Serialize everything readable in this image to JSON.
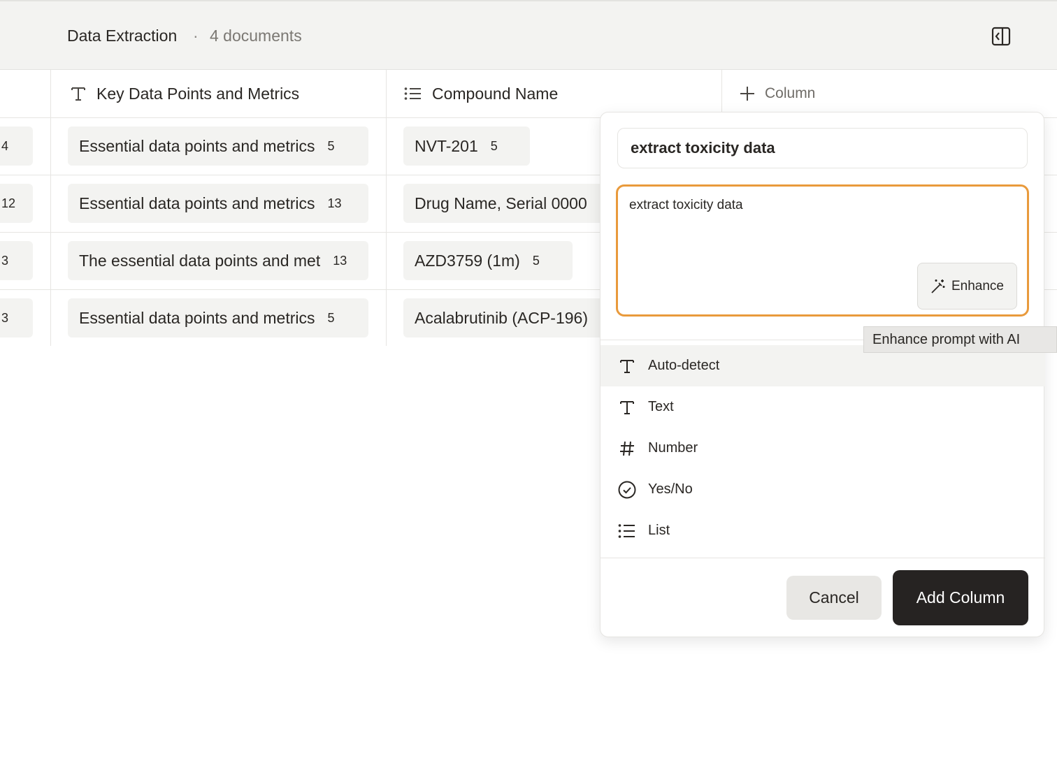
{
  "header": {
    "title": "Data Extraction",
    "separator": "·",
    "doc_count": "4 documents",
    "panel_toggle_icon": "sidebar-toggle-icon"
  },
  "table": {
    "columns": [
      {
        "label": "Key Data Points and Metrics",
        "icon": "text-type-icon"
      },
      {
        "label": "Compound Name",
        "icon": "list-type-icon"
      }
    ],
    "add_column_label": "Column",
    "rows": [
      {
        "lead": "4",
        "metrics": {
          "text": "Essential data points and metrics",
          "count": "5"
        },
        "compound": {
          "text": "NVT-201",
          "count": "5"
        }
      },
      {
        "lead": "12",
        "metrics": {
          "text": "Essential data points and metrics",
          "count": "13"
        },
        "compound": {
          "text": "Drug Name, Serial 0000",
          "count": ""
        }
      },
      {
        "lead": "3",
        "metrics": {
          "text": "The essential data points and met",
          "count": "13"
        },
        "compound": {
          "text": "AZD3759 (1m)",
          "count": "5"
        }
      },
      {
        "lead": "3",
        "metrics": {
          "text": "Essential data points and metrics",
          "count": "5"
        },
        "compound": {
          "text": "Acalabrutinib (ACP-196)",
          "count": ""
        }
      }
    ]
  },
  "popover": {
    "name_value": "extract toxicity data",
    "prompt_value": "extract toxicity data",
    "enhance_label": "Enhance",
    "types": [
      {
        "label": "Auto-detect",
        "icon": "text-type-icon",
        "selected": true
      },
      {
        "label": "Text",
        "icon": "text-type-icon"
      },
      {
        "label": "Number",
        "icon": "hash-icon"
      },
      {
        "label": "Yes/No",
        "icon": "check-circle-icon"
      },
      {
        "label": "List",
        "icon": "list-type-icon"
      }
    ],
    "cancel_label": "Cancel",
    "add_label": "Add Column"
  },
  "tooltip": {
    "text": "Enhance prompt with AI"
  },
  "colors": {
    "accent_focus": "#e99a3c",
    "primary_button": "#262322",
    "chip_bg": "#f3f3f1"
  }
}
